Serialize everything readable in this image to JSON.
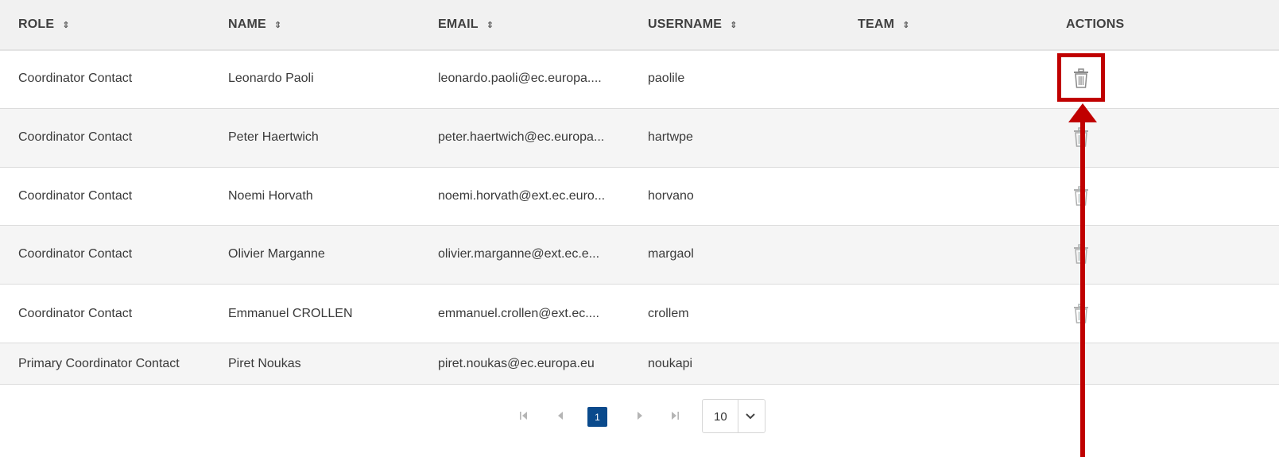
{
  "table": {
    "headers": {
      "role": "ROLE",
      "name": "NAME",
      "email": "EMAIL",
      "username": "USERNAME",
      "team": "TEAM",
      "actions": "ACTIONS"
    },
    "sort_glyph": "⇕",
    "rows": [
      {
        "role": "Coordinator Contact",
        "name": "Leonardo Paoli",
        "email": "leonardo.paoli@ec.europa....",
        "username": "paolile",
        "team": "",
        "delete_icon": "trash-icon"
      },
      {
        "role": "Coordinator Contact",
        "name": "Peter Haertwich",
        "email": "peter.haertwich@ec.europa...",
        "username": "hartwpe",
        "team": "",
        "delete_icon": "trash-icon"
      },
      {
        "role": "Coordinator Contact",
        "name": "Noemi Horvath",
        "email": "noemi.horvath@ext.ec.euro...",
        "username": "horvano",
        "team": "",
        "delete_icon": "trash-icon"
      },
      {
        "role": "Coordinator Contact",
        "name": "Olivier Marganne",
        "email": "olivier.marganne@ext.ec.e...",
        "username": "margaol",
        "team": "",
        "delete_icon": "trash-icon"
      },
      {
        "role": "Coordinator Contact",
        "name": "Emmanuel CROLLEN",
        "email": "emmanuel.crollen@ext.ec....",
        "username": "crollem",
        "team": "",
        "delete_icon": "trash-icon"
      },
      {
        "role": "Primary Coordinator Contact",
        "name": "Piret Noukas",
        "email": "piret.noukas@ec.europa.eu",
        "username": "noukapi",
        "team": ""
      }
    ]
  },
  "pagination": {
    "first": "⏮",
    "prev": "◀",
    "current_page": "1",
    "next": "▶",
    "last": "⏭",
    "page_size": "10"
  },
  "annotation": {
    "color": "#c00000",
    "target": "delete-button-row-1"
  },
  "colors": {
    "header_bg": "#f1f1f1",
    "row_alt_bg": "#f5f5f5",
    "accent": "#0a4a8c"
  }
}
